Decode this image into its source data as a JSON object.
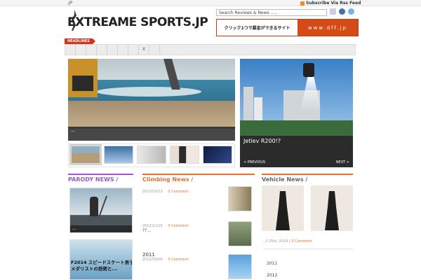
{
  "topbar": {
    "jp_label": ".JP",
    "rss_label": "Subscribe Via Rss Feed"
  },
  "logo": {
    "text": "EXTREAME SPORTS.JP"
  },
  "search": {
    "value": "Search Reviews & News ....."
  },
  "banner": {
    "left_text": "クリック1つで募金ができるサイト",
    "right_text": "www.dff.jp"
  },
  "headlines": {
    "label": "HEADLINES",
    "tabs": [
      "",
      "",
      "",
      "",
      "",
      "",
      "",
      "X",
      "",
      "",
      "",
      "",
      "",
      "",
      "",
      "",
      "",
      "",
      "",
      "",
      "",
      "",
      "",
      "",
      "",
      "",
      ""
    ]
  },
  "slider": {
    "caption": "..."
  },
  "feature": {
    "title": "Jetlev R200!?",
    "prev": "< PREVIOUS",
    "next": "NEXT >"
  },
  "sections": {
    "parody": {
      "title": "PARODY NEWS /",
      "thumb1_caption": "...",
      "thumb2_line1": "F2014 スピードスケート男子500",
      "thumb2_line2": "メダリストの技術と..."
    },
    "climbing": {
      "title": "Climbing News /",
      "entries": [
        {
          "date": "2013/10/13",
          "comments": "0 Comment",
          "sub": ""
        },
        {
          "date": "2012/11/15",
          "comments": "0 Comment",
          "sub": "??..."
        },
        {
          "date": "2012/09/00",
          "comments": "0 Comment",
          "sub": ""
        }
      ],
      "year_heading": "2011"
    },
    "vehicle": {
      "title": "Vehicle News /",
      "meta_date": ", 2 25th, 2014",
      "meta_comments": "0 Comment",
      "archive": [
        "2011",
        "2012"
      ]
    }
  },
  "colors": {
    "accent_orange": "#e07232",
    "accent_purple": "#9a5bcf",
    "banner_orange": "#d64a16",
    "headline_red": "#d3321f"
  },
  "icons": [
    "rss-icon",
    "flag-icon",
    "facebook-icon",
    "twitter-icon"
  ]
}
